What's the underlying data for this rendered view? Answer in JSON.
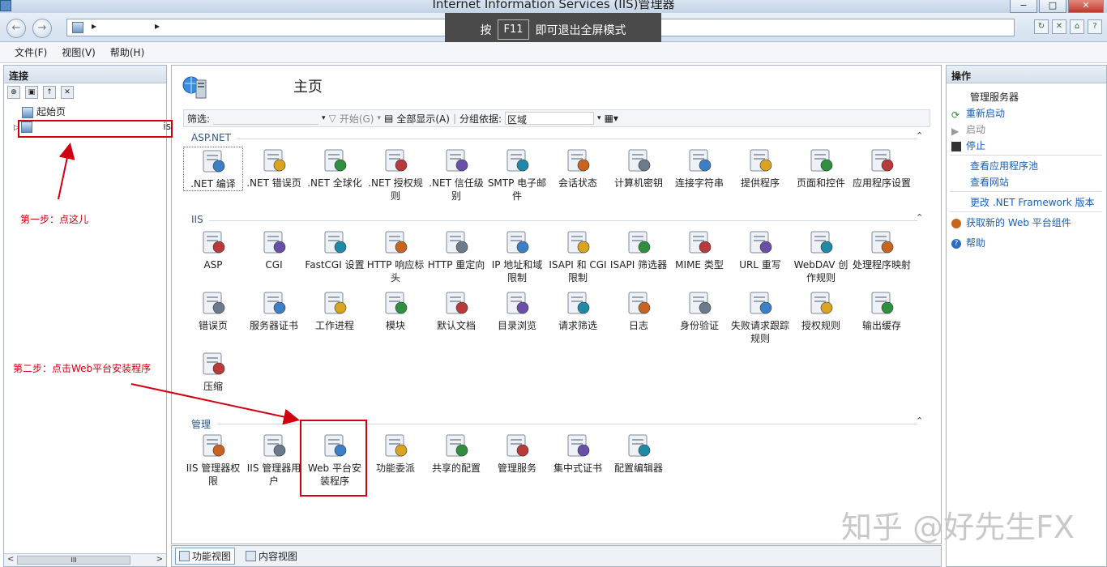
{
  "window": {
    "title": "Internet Information Services (IIS)管理器",
    "min": "−",
    "max": "□",
    "close": "✕"
  },
  "fullscreen_msg": {
    "pre": "按",
    "key": "F11",
    "post": "即可退出全屏模式"
  },
  "address": {
    "sep1": "▸",
    "sep2": "▸"
  },
  "menu": [
    "文件(F)",
    "视图(V)",
    "帮助(H)"
  ],
  "connections": {
    "title": "连接",
    "tree": [
      {
        "label": "起始页"
      },
      {
        "label": "",
        "suffix": "is"
      }
    ],
    "scroll": {
      "left": "<",
      "thumb": "III",
      "right": ">"
    }
  },
  "main": {
    "title": "主页",
    "filter": {
      "label": "筛选:",
      "start": "开始(G)",
      "show_all": "全部显示(A)",
      "group_label": "分组依据:",
      "group_value": "区域"
    },
    "sections": [
      {
        "name": "ASP.NET",
        "items": [
          ".NET 编译",
          ".NET 错误页",
          ".NET 全球化",
          ".NET 授权规则",
          ".NET 信任级别",
          "SMTP 电子邮件",
          "会话状态",
          "计算机密钥",
          "连接字符串",
          "提供程序",
          "页面和控件",
          "应用程序设置"
        ]
      },
      {
        "name": "IIS",
        "items": [
          "ASP",
          "CGI",
          "FastCGI 设置",
          "HTTP 响应标头",
          "HTTP 重定向",
          "IP 地址和域限制",
          "ISAPI 和 CGI 限制",
          "ISAPI 筛选器",
          "MIME 类型",
          "URL 重写",
          "WebDAV 创作规则",
          "处理程序映射",
          "错误页",
          "服务器证书",
          "工作进程",
          "模块",
          "默认文档",
          "目录浏览",
          "请求筛选",
          "日志",
          "身份验证",
          "失败请求跟踪规则",
          "授权规则",
          "输出缓存",
          "压缩"
        ]
      },
      {
        "name": "管理",
        "items": [
          "IIS 管理器权限",
          "IIS 管理器用户",
          "Web 平台安装程序",
          "功能委派",
          "共享的配置",
          "管理服务",
          "集中式证书",
          "配置编辑器"
        ]
      }
    ]
  },
  "bottom": {
    "feature_view": "功能视图",
    "content_view": "内容视图"
  },
  "actions": {
    "title": "操作",
    "manage_server": "管理服务器",
    "restart": "重新启动",
    "start": "启动",
    "stop": "停止",
    "view_pools": "查看应用程序池",
    "view_sites": "查看网站",
    "change_net": "更改 .NET Framework 版本",
    "get_web": "获取新的 Web 平台组件",
    "help": "帮助"
  },
  "annotations": {
    "step1": "第一步：点这儿",
    "step2": "第二步：点击Web平台安装程序"
  },
  "watermark": "知乎 @好先生FX",
  "colors": {
    "annotation": "#d00010",
    "link": "#1a5fb4"
  }
}
